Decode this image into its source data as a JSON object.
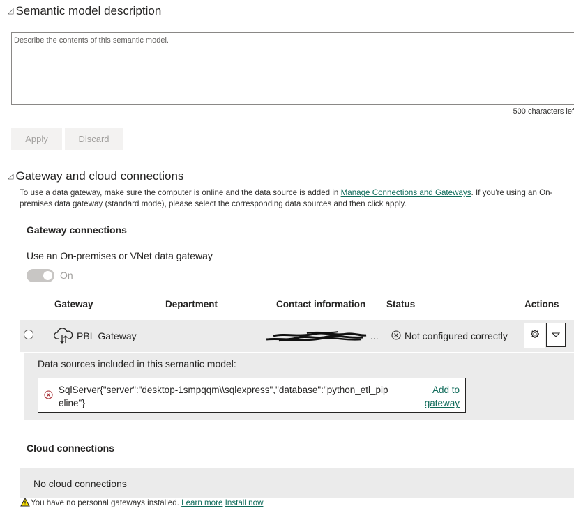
{
  "description_section": {
    "title": "Semantic model description",
    "placeholder": "Describe the contents of this semantic model.",
    "char_count": "500 characters lef",
    "apply_label": "Apply",
    "discard_label": "Discard"
  },
  "gateway_section": {
    "title": "Gateway and cloud connections",
    "intro_before": "To use a data gateway, make sure the computer is online and the data source is added in ",
    "intro_link": "Manage Connections and Gateways",
    "intro_after": ". If you're using an On-premises data gateway (standard mode), please select the corresponding data sources and then click apply.",
    "gateway_connections_title": "Gateway connections",
    "use_gateway_label": "Use an On-premises or VNet data gateway",
    "toggle_state": "On",
    "columns": {
      "gateway": "Gateway",
      "department": "Department",
      "contact": "Contact information",
      "status": "Status",
      "actions": "Actions"
    },
    "row": {
      "gateway_name": "PBI_Gateway",
      "contact_suffix": "...",
      "status": "Not configured correctly"
    },
    "data_sources": {
      "label": "Data sources included in this semantic model:",
      "source_text": "SqlServer{\"server\":\"desktop-1smpqqm\\\\sqlexpress\",\"database\":\"python_etl_pipeline\"}",
      "add_link": "Add to gateway"
    },
    "cloud_connections_title": "Cloud connections",
    "cloud_empty": "No cloud connections",
    "warning": {
      "text": "You have no personal gateways installed. ",
      "learn_more": "Learn more",
      "install_now": "Install now"
    }
  },
  "colors": {
    "link": "#0f6b5a",
    "error": "#a4262c",
    "warning": "#fce100"
  }
}
